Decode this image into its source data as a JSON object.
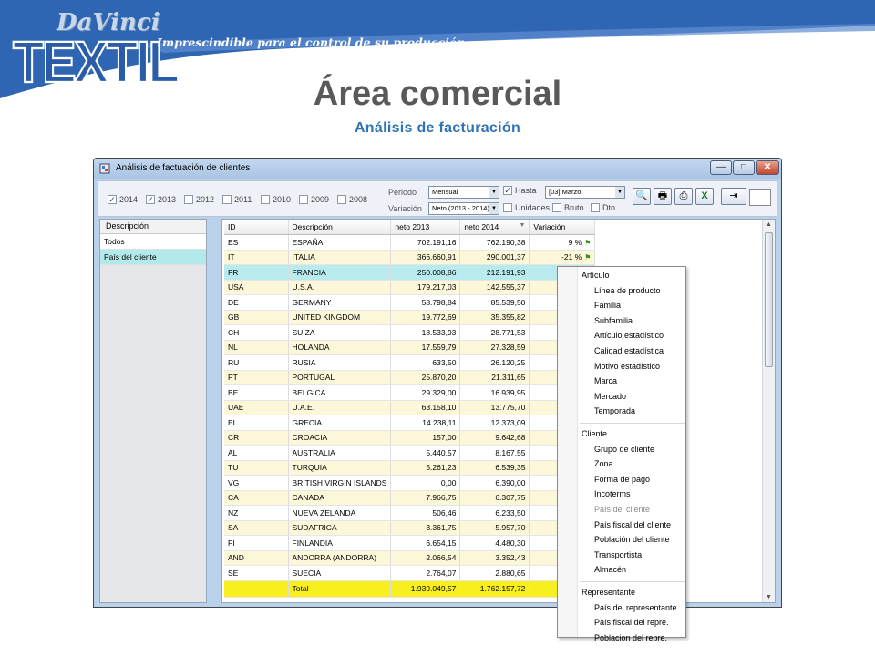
{
  "banner": {
    "logo_top": "DaVinci",
    "logo_bottom": "TEXTIL",
    "tagline": "Imprescindible para el control de su producción",
    "colors": {
      "band": "#2f66b4",
      "band_light": "#5f8dd0"
    }
  },
  "slide": {
    "title": "Área comercial",
    "subtitle": "Análisis de facturación"
  },
  "window": {
    "title": "Análisis de factuación de clientes",
    "icon": "app-icon",
    "controls": {
      "minimize": "—",
      "maximize": "□",
      "close": "✕"
    }
  },
  "toolbar": {
    "years": [
      {
        "label": "2014",
        "checked": true
      },
      {
        "label": "2013",
        "checked": true
      },
      {
        "label": "2012",
        "checked": false
      },
      {
        "label": "2011",
        "checked": false
      },
      {
        "label": "2010",
        "checked": false
      },
      {
        "label": "2009",
        "checked": false
      },
      {
        "label": "2008",
        "checked": false
      }
    ],
    "periodo_label": "Periodo",
    "periodo_value": "Mensual",
    "hasta_label": "Hasta",
    "hasta_checked": true,
    "hasta_value": "[03] Marzo",
    "variacion_label": "Variación",
    "variacion_value": "Neto (2013 - 2014)",
    "unidades_label": "Unidades",
    "bruto_label": "Bruto",
    "dto_label": "Dto.",
    "buttons": [
      "search-icon",
      "print-icon",
      "print-preview-icon",
      "excel-icon",
      "export-icon"
    ]
  },
  "left_panel": {
    "header": "Descripción",
    "items": [
      {
        "label": "Todos",
        "selected": false
      },
      {
        "label": "País del cliente",
        "selected": true
      }
    ]
  },
  "grid": {
    "columns": [
      "ID",
      "Descripción",
      "neto 2013",
      "neto 2014",
      "Variación"
    ],
    "sort_indicator": "▼",
    "rows": [
      {
        "id": "ES",
        "desc": "ESPAÑA",
        "n2013": "702.191,16",
        "n2014": "762.190,38",
        "var": "9 %",
        "flag": "⚑"
      },
      {
        "id": "IT",
        "desc": "ITALIA",
        "n2013": "366.660,91",
        "n2014": "290.001,37",
        "var": "-21 %",
        "flag": "⚑"
      },
      {
        "id": "FR",
        "desc": "FRANCIA",
        "n2013": "250.008,86",
        "n2014": "212.191,93",
        "var": "",
        "flag": ""
      },
      {
        "id": "USA",
        "desc": "U.S.A.",
        "n2013": "179.217,03",
        "n2014": "142.555,37",
        "var": "",
        "flag": ""
      },
      {
        "id": "DE",
        "desc": "GERMANY",
        "n2013": "58.798,84",
        "n2014": "85.539,50",
        "var": "",
        "flag": ""
      },
      {
        "id": "GB",
        "desc": "UNITED KINGDOM",
        "n2013": "19.772,69",
        "n2014": "35.355,82",
        "var": "",
        "flag": ""
      },
      {
        "id": "CH",
        "desc": "SUIZA",
        "n2013": "18.533,93",
        "n2014": "28.771,53",
        "var": "",
        "flag": ""
      },
      {
        "id": "NL",
        "desc": "HOLANDA",
        "n2013": "17.559,79",
        "n2014": "27.328,59",
        "var": "",
        "flag": ""
      },
      {
        "id": "RU",
        "desc": "RUSIA",
        "n2013": "633,50",
        "n2014": "26.120,25",
        "var": "",
        "flag": ""
      },
      {
        "id": "PT",
        "desc": "PORTUGAL",
        "n2013": "25.870,20",
        "n2014": "21.311,65",
        "var": "",
        "flag": ""
      },
      {
        "id": "BE",
        "desc": "BELGICA",
        "n2013": "29.329,00",
        "n2014": "16.939,95",
        "var": "",
        "flag": ""
      },
      {
        "id": "UAE",
        "desc": "U.A.E.",
        "n2013": "63.158,10",
        "n2014": "13.775,70",
        "var": "",
        "flag": ""
      },
      {
        "id": "EL",
        "desc": "GRECIA",
        "n2013": "14.238,11",
        "n2014": "12.373,09",
        "var": "",
        "flag": ""
      },
      {
        "id": "CR",
        "desc": "CROACIA",
        "n2013": "157,00",
        "n2014": "9.642,68",
        "var": "",
        "flag": ""
      },
      {
        "id": "AL",
        "desc": "AUSTRALIA",
        "n2013": "5.440,57",
        "n2014": "8.167,55",
        "var": "",
        "flag": ""
      },
      {
        "id": "TU",
        "desc": "TURQUIA",
        "n2013": "5.261,23",
        "n2014": "6.539,35",
        "var": "",
        "flag": ""
      },
      {
        "id": "VG",
        "desc": "BRITISH VIRGIN ISLANDS",
        "n2013": "0,00",
        "n2014": "6.390,00",
        "var": "",
        "flag": ""
      },
      {
        "id": "CA",
        "desc": "CANADA",
        "n2013": "7.966,75",
        "n2014": "6.307,75",
        "var": "",
        "flag": ""
      },
      {
        "id": "NZ",
        "desc": "NUEVA ZELANDA",
        "n2013": "506,46",
        "n2014": "6.233,50",
        "var": "",
        "flag": ""
      },
      {
        "id": "SA",
        "desc": "SUDAFRICA",
        "n2013": "3.361,75",
        "n2014": "5.957,70",
        "var": "",
        "flag": ""
      },
      {
        "id": "FI",
        "desc": "FINLANDIA",
        "n2013": "6.654,15",
        "n2014": "4.480,30",
        "var": "",
        "flag": ""
      },
      {
        "id": "AND",
        "desc": "ANDORRA (ANDORRA)",
        "n2013": "2.066,54",
        "n2014": "3.352,43",
        "var": "",
        "flag": ""
      },
      {
        "id": "SE",
        "desc": "SUECIA",
        "n2013": "2.764,07",
        "n2014": "2.880,65",
        "var": "",
        "flag": ""
      }
    ],
    "selected_row": 2,
    "total": {
      "desc": "Total",
      "n2013": "1.939.049,57",
      "n2014": "1.762.157,72"
    }
  },
  "context_menu": {
    "groups": [
      {
        "header": "Artículo",
        "items": [
          {
            "label": "Línea de producto"
          },
          {
            "label": "Familia"
          },
          {
            "label": "Subfamilia"
          },
          {
            "label": "Artículo estadístico"
          },
          {
            "label": "Calidad estadística"
          },
          {
            "label": "Motivo estadístico"
          },
          {
            "label": "Marca"
          },
          {
            "label": "Mercado"
          },
          {
            "label": "Temporada"
          }
        ]
      },
      {
        "header": "Cliente",
        "items": [
          {
            "label": "Grupo de cliente"
          },
          {
            "label": "Zona"
          },
          {
            "label": "Forma de pago"
          },
          {
            "label": "Incoterms"
          },
          {
            "label": "País del cliente",
            "disabled": true
          },
          {
            "label": "País fiscal del cliente"
          },
          {
            "label": "Población del cliente"
          },
          {
            "label": "Transportista"
          },
          {
            "label": "Almacén"
          }
        ]
      },
      {
        "header": "Representante",
        "items": [
          {
            "label": "País del representante"
          },
          {
            "label": "País fiscal del repre."
          },
          {
            "label": "Poblacion del repre."
          }
        ]
      }
    ]
  }
}
